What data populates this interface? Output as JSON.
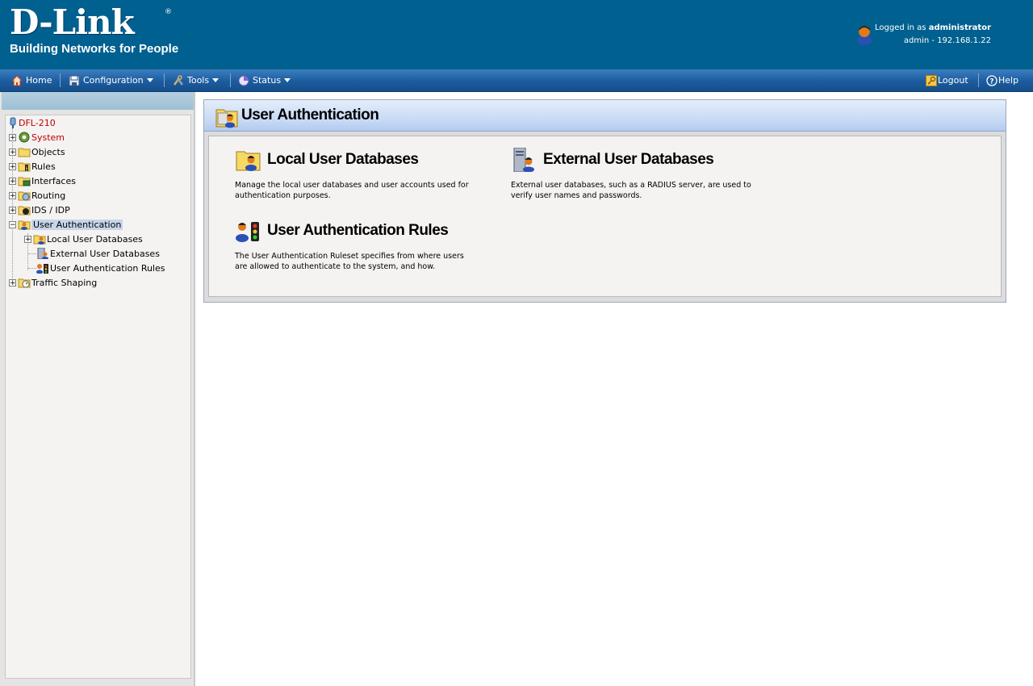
{
  "header": {
    "logo_main": "D-Link",
    "logo_reg": "®",
    "logo_tagline": "Building Networks for People",
    "logged_in_prefix": "Logged in as ",
    "logged_in_user": "administrator",
    "session": "admin - 192.168.1.22"
  },
  "menubar": {
    "home": "Home",
    "configuration": "Configuration",
    "tools": "Tools",
    "status": "Status",
    "logout": "Logout",
    "help": "Help"
  },
  "tree": {
    "root": "DFL-210",
    "items": [
      {
        "label": "System"
      },
      {
        "label": "Objects"
      },
      {
        "label": "Rules"
      },
      {
        "label": "Interfaces"
      },
      {
        "label": "Routing"
      },
      {
        "label": "IDS / IDP"
      },
      {
        "label": "User Authentication"
      },
      {
        "label": "Local User Databases"
      },
      {
        "label": "External User Databases"
      },
      {
        "label": "User Authentication Rules"
      },
      {
        "label": "Traffic Shaping"
      }
    ]
  },
  "content": {
    "title": "User Authentication",
    "cards": [
      {
        "title": "Local User Databases",
        "desc": "Manage the local user databases and user accounts used for authentication purposes."
      },
      {
        "title": "External User Databases",
        "desc": "External user databases, such as a RADIUS server, are used to verify user names and passwords."
      },
      {
        "title": "User Authentication Rules",
        "desc": "The User Authentication Ruleset specifies from where users are allowed to authenticate to the system, and how."
      }
    ]
  },
  "colors": {
    "header_bg": "#00608f",
    "menubar_bg": "#1c5c9e",
    "selected_tree": "#c6d5ea",
    "tree_red": "#c00000"
  }
}
